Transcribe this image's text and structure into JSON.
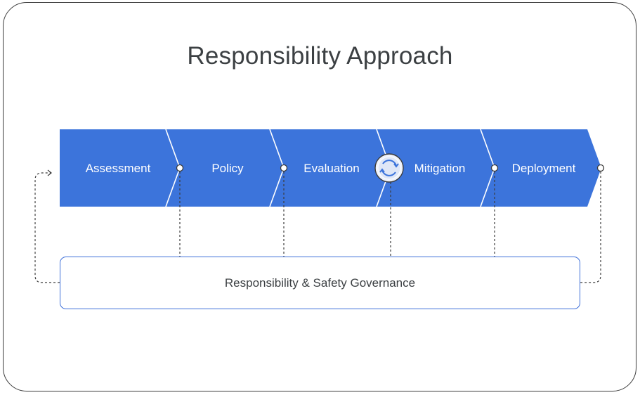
{
  "title": "Responsibility Approach",
  "steps": [
    {
      "label": "Assessment"
    },
    {
      "label": "Policy"
    },
    {
      "label": "Evaluation"
    },
    {
      "label": "Mitigation"
    },
    {
      "label": "Deployment"
    }
  ],
  "governance": {
    "label": "Responsibility & Safety Governance"
  },
  "colors": {
    "chevron_fill": "#3c74db",
    "box_border": "#3d6fd9",
    "title_text": "#3c4043"
  },
  "icons": [
    "refresh-cycle-icon",
    "loop-back-arrow-icon"
  ]
}
